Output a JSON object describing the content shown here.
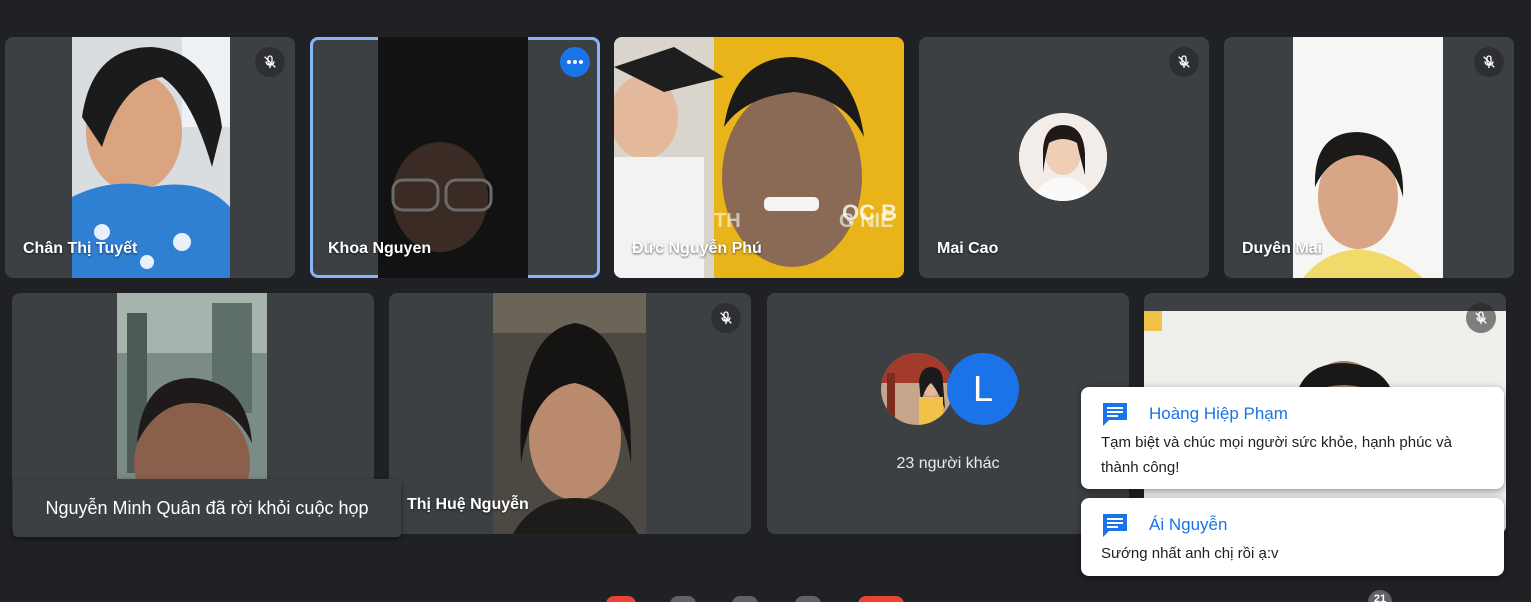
{
  "participants": [
    {
      "name": "Chân Thị Tuyết",
      "muted": true
    },
    {
      "name": "Khoa Nguyen",
      "muted": false,
      "active": true
    },
    {
      "name": "Đức Nguyễn Phú",
      "muted": false,
      "background_text": "ỌC B\nTH     G NIỀ"
    },
    {
      "name": "Mai Cao",
      "muted": true
    },
    {
      "name": "Duyên Mai",
      "muted": true
    },
    {
      "name": "",
      "muted": false
    },
    {
      "name": "Thị Huệ Nguyễn",
      "muted": true
    },
    {
      "name": "",
      "muted": true
    }
  ],
  "others_tile": {
    "avatar_letter": "L",
    "label": "23 người khác"
  },
  "toast": {
    "text": "Nguyễn Minh Quân đã rời khỏi cuộc họp"
  },
  "chat_notifications": [
    {
      "sender": "Hoàng Hiệp Phạm",
      "message": "Tạm biệt và chúc mọi người sức khỏe, hạnh phúc và thành công!"
    },
    {
      "sender": "Ái Nguyễn",
      "message": "Sướng nhất anh chị rồi ạ:v"
    }
  ],
  "participant_badge": "21",
  "icons": {
    "mute": "mic-off-icon",
    "more": "more-options-icon",
    "chat": "chat-icon"
  },
  "colors": {
    "background": "#202124",
    "tile": "#3c4043",
    "active_border": "#8ab4f8",
    "accent": "#1a73e8"
  }
}
